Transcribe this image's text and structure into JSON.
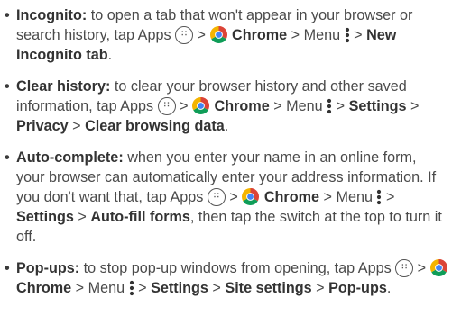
{
  "items": [
    {
      "term": "Incognito:",
      "segments": [
        {
          "t": "text",
          "v": " to open a tab that won't appear in your browser or search history, tap Apps "
        },
        {
          "t": "icon",
          "v": "apps-icon"
        },
        {
          "t": "text",
          "v": " > "
        },
        {
          "t": "icon",
          "v": "chrome-icon"
        },
        {
          "t": "bold",
          "v": " Chrome"
        },
        {
          "t": "text",
          "v": " > Menu "
        },
        {
          "t": "icon",
          "v": "menu-dots-icon"
        },
        {
          "t": "text",
          "v": " > "
        },
        {
          "t": "bold",
          "v": "New Incognito tab"
        },
        {
          "t": "text",
          "v": "."
        }
      ]
    },
    {
      "term": "Clear history:",
      "segments": [
        {
          "t": "text",
          "v": " to clear your browser history and other saved information, tap Apps "
        },
        {
          "t": "icon",
          "v": "apps-icon"
        },
        {
          "t": "text",
          "v": " > "
        },
        {
          "t": "icon",
          "v": "chrome-icon"
        },
        {
          "t": "bold",
          "v": " Chrome"
        },
        {
          "t": "text",
          "v": " > Menu "
        },
        {
          "t": "icon",
          "v": "menu-dots-icon"
        },
        {
          "t": "text",
          "v": " > "
        },
        {
          "t": "bold",
          "v": "Settings"
        },
        {
          "t": "text",
          "v": " > "
        },
        {
          "t": "bold",
          "v": "Privacy"
        },
        {
          "t": "text",
          "v": " > "
        },
        {
          "t": "bold",
          "v": "Clear browsing data"
        },
        {
          "t": "text",
          "v": "."
        }
      ]
    },
    {
      "term": "Auto-complete:",
      "segments": [
        {
          "t": "text",
          "v": " when you enter your name in an online form, your browser can automatically enter your address information. If you don't want that, tap Apps "
        },
        {
          "t": "icon",
          "v": "apps-icon"
        },
        {
          "t": "text",
          "v": " > "
        },
        {
          "t": "icon",
          "v": "chrome-icon"
        },
        {
          "t": "bold",
          "v": " Chrome"
        },
        {
          "t": "text",
          "v": " > Menu "
        },
        {
          "t": "icon",
          "v": "menu-dots-icon"
        },
        {
          "t": "text",
          "v": " > "
        },
        {
          "t": "bold",
          "v": "Settings"
        },
        {
          "t": "text",
          "v": " > "
        },
        {
          "t": "bold",
          "v": "Auto-fill forms"
        },
        {
          "t": "text",
          "v": ", then tap the switch at the top to turn it off."
        }
      ]
    },
    {
      "term": "Pop-ups:",
      "segments": [
        {
          "t": "text",
          "v": " to stop pop-up windows from opening, tap Apps "
        },
        {
          "t": "icon",
          "v": "apps-icon"
        },
        {
          "t": "text",
          "v": " > "
        },
        {
          "t": "icon",
          "v": "chrome-icon"
        },
        {
          "t": "bold",
          "v": " Chrome"
        },
        {
          "t": "text",
          "v": " > Menu "
        },
        {
          "t": "icon",
          "v": "menu-dots-icon"
        },
        {
          "t": "text",
          "v": " > "
        },
        {
          "t": "bold",
          "v": "Settings"
        },
        {
          "t": "text",
          "v": " > "
        },
        {
          "t": "bold",
          "v": "Site settings"
        },
        {
          "t": "text",
          "v": " > "
        },
        {
          "t": "bold",
          "v": "Pop-ups"
        },
        {
          "t": "text",
          "v": "."
        }
      ]
    }
  ],
  "colors": {
    "text": "#4a4a4a",
    "bold": "#333333",
    "chrome_red": "#DB4437",
    "chrome_yellow": "#F4B400",
    "chrome_green": "#0F9D58",
    "chrome_blue": "#4285F4"
  }
}
